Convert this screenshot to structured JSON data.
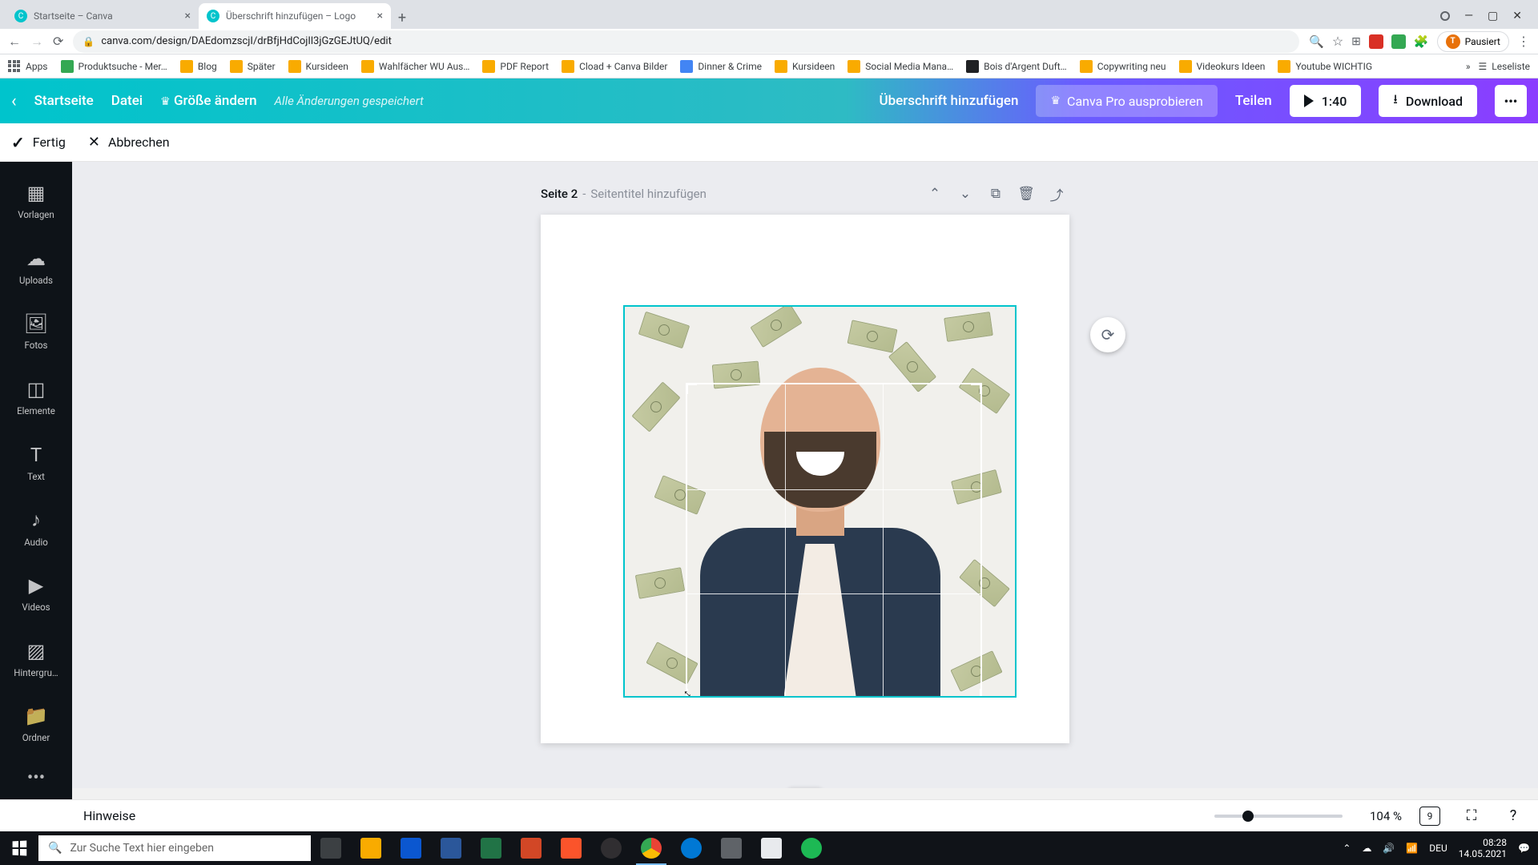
{
  "browser": {
    "tabs": [
      {
        "title": "Startseite – Canva",
        "active": false
      },
      {
        "title": "Überschrift hinzufügen – Logo",
        "active": true
      }
    ],
    "url": "canva.com/design/DAEdomzscjI/drBfjHdCojIl3jGzGEJtUQ/edit",
    "profile_label": "Pausiert",
    "profile_initial": "T"
  },
  "bookmarks": {
    "apps": "Apps",
    "items": [
      "Produktsuche - Mer…",
      "Blog",
      "Später",
      "Kursideen",
      "Wahlfächer WU Aus…",
      "PDF Report",
      "Cload + Canva Bilder",
      "Dinner & Crime",
      "Kursideen",
      "Social Media Mana…",
      "Bois d'Argent Duft…",
      "Copywriting neu",
      "Videokurs Ideen",
      "Youtube WICHTIG"
    ],
    "reading_list": "Leseliste"
  },
  "header": {
    "home": "Startseite",
    "file": "Datei",
    "resize": "Größe ändern",
    "saved": "Alle Änderungen gespeichert",
    "doc_title": "Überschrift hinzufügen",
    "try_pro": "Canva Pro ausprobieren",
    "share": "Teilen",
    "duration": "1:40",
    "download": "Download"
  },
  "crop_bar": {
    "done": "Fertig",
    "cancel": "Abbrechen"
  },
  "sidebar": {
    "items": [
      "Vorlagen",
      "Uploads",
      "Fotos",
      "Elemente",
      "Text",
      "Audio",
      "Videos",
      "Hintergru…",
      "Ordner"
    ]
  },
  "page": {
    "label": "Seite 2",
    "separator": " - ",
    "title_placeholder": "Seitentitel hinzufügen"
  },
  "footer": {
    "notes": "Hinweise",
    "zoom": "104 %",
    "page_count": "9"
  },
  "taskbar": {
    "search_placeholder": "Zur Suche Text hier eingeben",
    "lang": "DEU",
    "time": "08:28",
    "date": "14.05.2021"
  }
}
